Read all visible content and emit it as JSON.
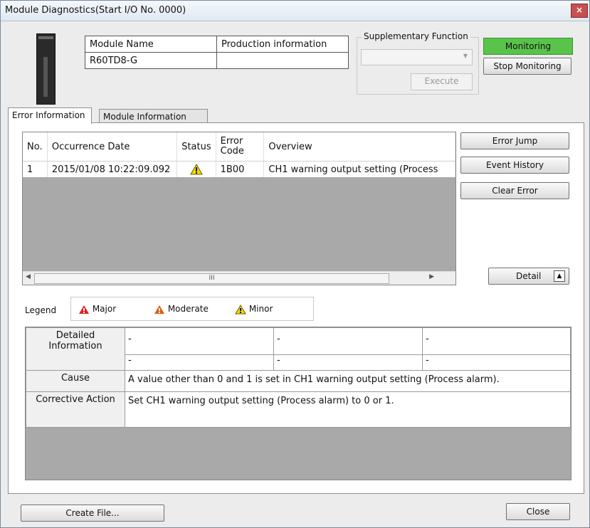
{
  "window": {
    "title": "Module Diagnostics(Start I/O No. 0000)",
    "close_glyph": "×"
  },
  "module_table": {
    "headers": [
      "Module Name",
      "Production information"
    ],
    "row": [
      "R60TD8-G",
      ""
    ]
  },
  "supplementary": {
    "legend": "Supplementary Function",
    "combo_value": "",
    "execute_label": "Execute"
  },
  "monitoring": {
    "status_label": "Monitoring",
    "stop_label": "Stop Monitoring",
    "status_color": "#5ac34c"
  },
  "tabs": [
    {
      "label": "Error Information",
      "active": true
    },
    {
      "label": "Module Information List",
      "active": false
    }
  ],
  "error_list": {
    "headers": [
      "No.",
      "Occurrence Date",
      "Status",
      "Error Code",
      "Overview"
    ],
    "rows": [
      {
        "no": "1",
        "date": "2015/01/08 10:22:09.092",
        "status_icon": "minor-warning-icon",
        "code": "1B00",
        "overview": "CH1 warning output setting (Process"
      }
    ],
    "scroll_thumb_glyph": "III"
  },
  "side_buttons": {
    "error_jump": "Error Jump",
    "event_history": "Event History",
    "clear_error": "Clear Error",
    "detail": "Detail"
  },
  "legend": {
    "label": "Legend",
    "items": [
      {
        "label": "Major",
        "color": "#e02020"
      },
      {
        "label": "Moderate",
        "color": "#e05a10"
      },
      {
        "label": "Minor",
        "color": "#f5d800"
      }
    ]
  },
  "details": {
    "detailed_information_label": "Detailed Information",
    "info_cells": [
      "-",
      "-",
      "-",
      "-",
      "-",
      "-"
    ],
    "cause_label": "Cause",
    "cause_text": "A value other than 0 and 1 is set in CH1 warning output setting (Process alarm).",
    "corrective_label": "Corrective Action",
    "corrective_text": "Set CH1 warning output setting (Process alarm) to 0 or 1."
  },
  "footer": {
    "create_file": "Create File...",
    "close": "Close"
  }
}
